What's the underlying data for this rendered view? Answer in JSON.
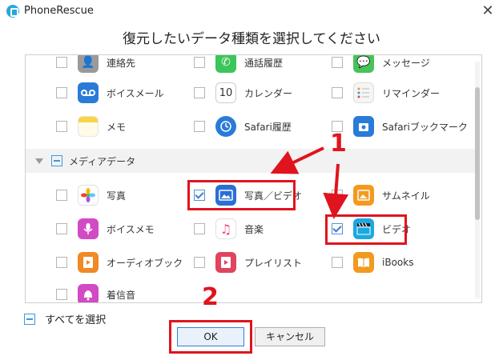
{
  "window": {
    "app_title": "PhoneRescue",
    "close_glyph": "✕"
  },
  "heading": "復元したいデータ種類を選択してください",
  "items_top": [
    {
      "label": "連絡先",
      "icon": "contacts-icon",
      "checked": false
    },
    {
      "label": "通話履歴",
      "icon": "phone-icon",
      "checked": false
    },
    {
      "label": "メッセージ",
      "icon": "messages-icon",
      "checked": false
    }
  ],
  "items_row2": [
    {
      "label": "ボイスメール",
      "icon": "voicemail-icon",
      "checked": false
    },
    {
      "label": "カレンダー",
      "icon": "calendar-icon",
      "checked": false,
      "day": "10"
    },
    {
      "label": "リマインダー",
      "icon": "reminders-icon",
      "checked": false
    }
  ],
  "items_row3": [
    {
      "label": "メモ",
      "icon": "notes-icon",
      "checked": false
    },
    {
      "label": "Safari履歴",
      "icon": "safari-history-icon",
      "checked": false
    },
    {
      "label": "Safariブックマーク",
      "icon": "safari-bookmark-icon",
      "checked": false
    }
  ],
  "section": {
    "label": "メディアデータ"
  },
  "media_row1": [
    {
      "label": "写真",
      "icon": "photos-icon",
      "checked": false
    },
    {
      "label": "写真／ビデオ",
      "icon": "photo-video-icon",
      "checked": true
    },
    {
      "label": "サムネイル",
      "icon": "thumbnail-icon",
      "checked": false
    }
  ],
  "media_row2": [
    {
      "label": "ボイスメモ",
      "icon": "voice-memo-icon",
      "checked": false
    },
    {
      "label": "音楽",
      "icon": "music-icon",
      "checked": false
    },
    {
      "label": "ビデオ",
      "icon": "video-icon",
      "checked": true
    }
  ],
  "media_row3": [
    {
      "label": "オーディオブック",
      "icon": "audiobook-icon",
      "checked": false
    },
    {
      "label": "プレイリスト",
      "icon": "playlist-icon",
      "checked": false
    },
    {
      "label": "iBooks",
      "icon": "ibooks-icon",
      "checked": false
    }
  ],
  "media_row4": [
    {
      "label": "着信音",
      "icon": "ringtone-icon",
      "checked": false
    }
  ],
  "select_all_label": "すべてを選択",
  "buttons": {
    "ok": "OK",
    "cancel": "キャンセル"
  },
  "annotations": {
    "step1": "1",
    "step2": "2"
  },
  "colors": {
    "annotation_red": "#e0141e",
    "accent_blue": "#3a9ad9"
  }
}
